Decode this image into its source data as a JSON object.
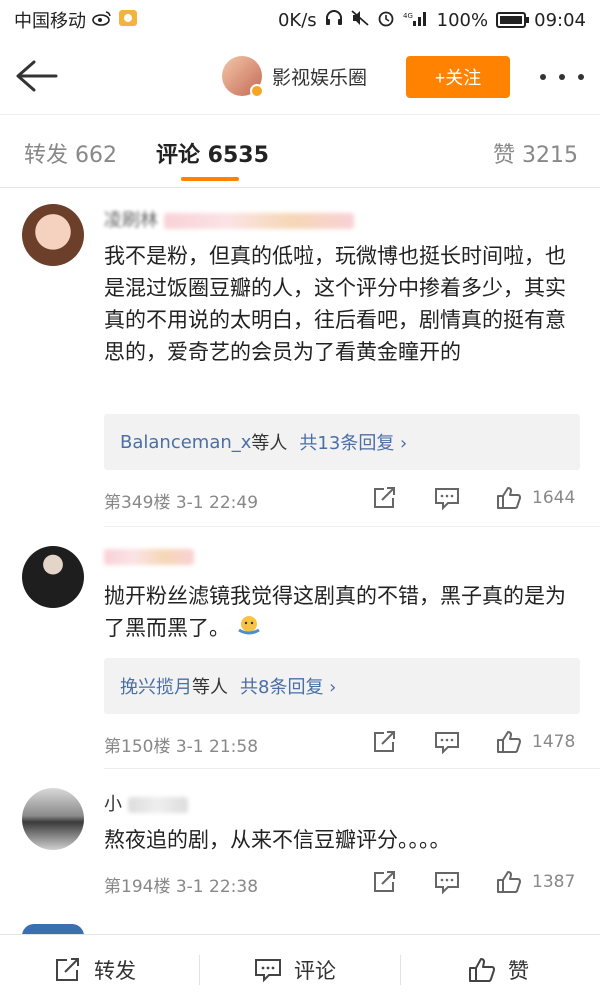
{
  "status_bar": {
    "carrier": "中国移动",
    "speed": "0K/s",
    "network": "4G",
    "battery": "100%",
    "time": "09:04"
  },
  "header": {
    "account_name": "影视娱乐圈",
    "follow_label": "+关注"
  },
  "tabs": {
    "repost": "转发 662",
    "comment": "评论 6535",
    "like": "赞 3215"
  },
  "comments": [
    {
      "name_visible": "凌刷林",
      "text": "我不是粉，但真的低啦，玩微博也挺长时间啦，也是混过饭圈豆瓣的人，这个评分中掺着多少，其实真的不用说的太明白，往后看吧，剧情真的挺有意思的，爱奇艺的会员为了看黄金瞳开的",
      "reply_user": "Balanceman_x",
      "reply_suffix": "等人",
      "reply_count": "共13条回复 ›",
      "meta": "第349楼  3-1 22:49",
      "likes": "1644"
    },
    {
      "name_visible": "",
      "text": "抛开粉丝滤镜我觉得这剧真的不错，黑子真的是为了黑而黑了。",
      "reply_user": "挽兴揽月",
      "reply_suffix": "等人",
      "reply_count": "共8条回复 ›",
      "meta": "第150楼  3-1 21:58",
      "likes": "1478"
    },
    {
      "name_visible": "小",
      "text": "熬夜追的剧，从来不信豆瓣评分。。。。",
      "meta": "第194楼  3-1 22:38",
      "likes": "1387"
    }
  ],
  "bottom_bar": {
    "repost": "转发",
    "comment": "评论",
    "like": "赞"
  },
  "colors": {
    "accent": "#ff8200",
    "link": "#4a6fa5",
    "meta": "#888888"
  }
}
